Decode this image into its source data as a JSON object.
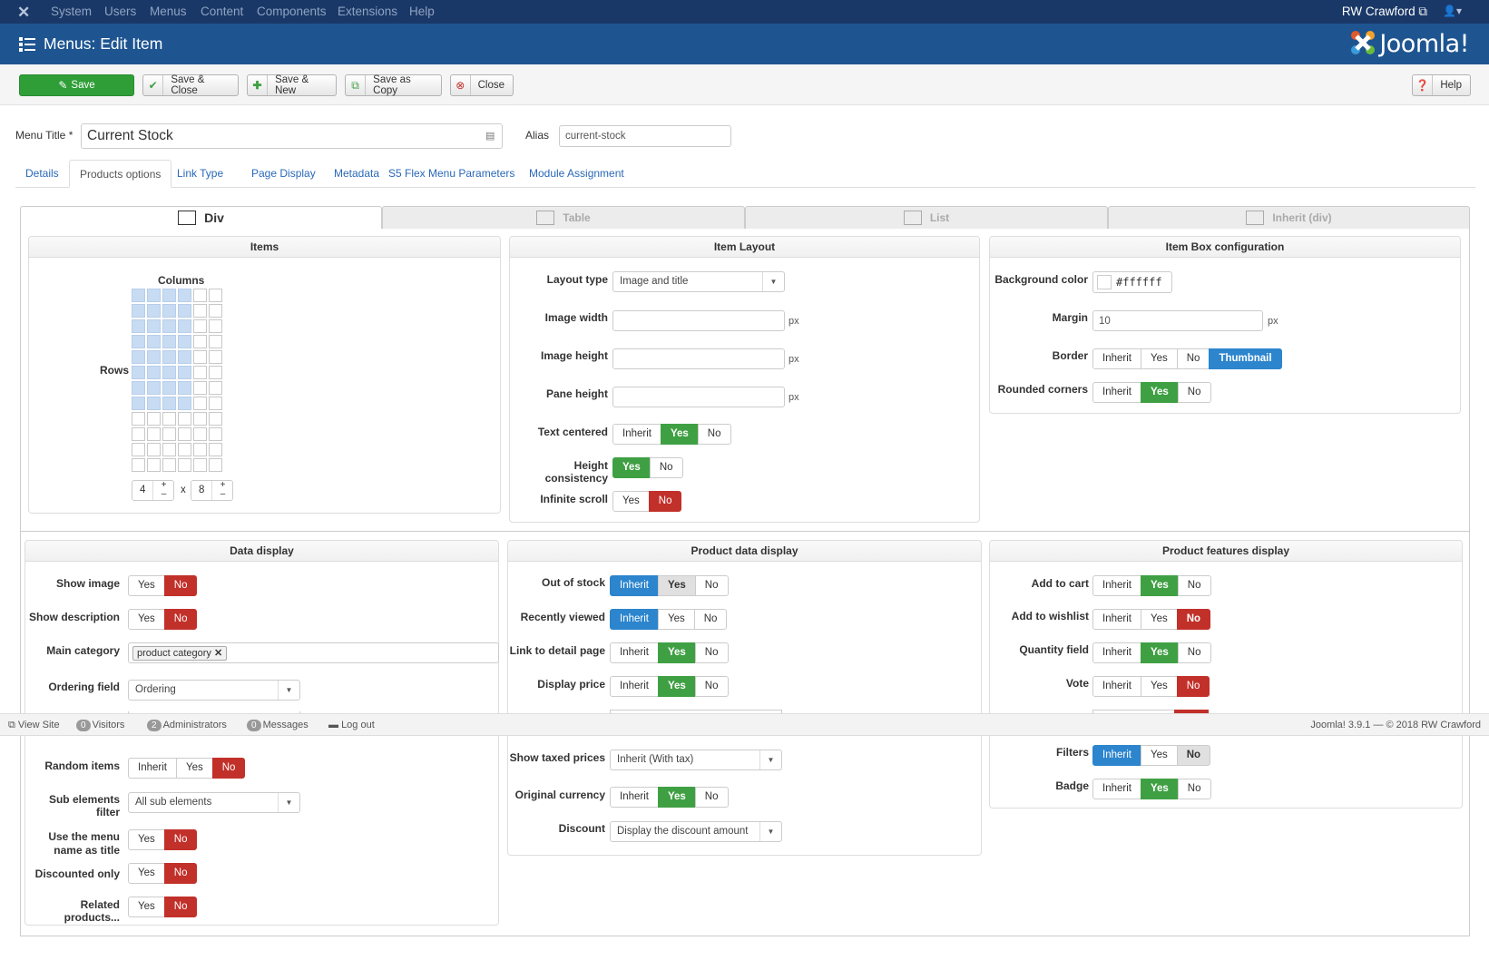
{
  "topnav": {
    "items": [
      "System",
      "Users",
      "Menus",
      "Content",
      "Components",
      "Extensions",
      "Help"
    ],
    "user": "RW Crawford"
  },
  "header": {
    "title": "Menus: Edit Item",
    "brand": "Joomla!"
  },
  "toolbar": {
    "save": "Save",
    "save_close": "Save & Close",
    "save_new": "Save & New",
    "save_copy": "Save as Copy",
    "close": "Close",
    "help": "Help"
  },
  "form": {
    "menu_title_label": "Menu Title *",
    "menu_title_value": "Current Stock",
    "alias_label": "Alias",
    "alias_value": "current-stock"
  },
  "tabs": [
    "Details",
    "Products options",
    "Link Type",
    "Page Display",
    "Metadata",
    "S5 Flex Menu Parameters",
    "Module Assignment"
  ],
  "layout_tabs": [
    "Div",
    "Table",
    "List",
    "Inherit (div)"
  ],
  "items_panel": {
    "title": "Items",
    "columns_label": "Columns",
    "rows_label": "Rows",
    "cols_value": "4",
    "rows_value": "8",
    "times": "x",
    "plus": "+",
    "minus": "–",
    "selected_cols": 4,
    "selected_rows": 8,
    "grid_cols": 6,
    "grid_rows": 12
  },
  "item_layout": {
    "title": "Item Layout",
    "layout_type_label": "Layout type",
    "layout_type_value": "Image and title",
    "image_width_label": "Image width",
    "image_height_label": "Image height",
    "pane_height_label": "Pane height",
    "px": "px",
    "text_centered_label": "Text centered",
    "height_consistency_label": "Height consistency",
    "infinite_scroll_label": "Infinite scroll"
  },
  "item_box": {
    "title": "Item Box configuration",
    "bg_label": "Background color",
    "bg_value": "#ffffff",
    "margin_label": "Margin",
    "margin_value": "10",
    "border_label": "Border",
    "rounded_label": "Rounded corners"
  },
  "labels": {
    "inherit": "Inherit",
    "yes": "Yes",
    "no": "No",
    "thumbnail": "Thumbnail"
  },
  "data_display": {
    "title": "Data display",
    "show_image": "Show image",
    "show_description": "Show description",
    "main_category": "Main category",
    "category_tag": "product category",
    "ordering_field": "Ordering field",
    "ordering_value": "Ordering",
    "random_items": "Random items",
    "sub_filter": "Sub elements filter",
    "sub_filter_value": "All sub elements",
    "use_menu_name_1": "Use the menu",
    "use_menu_name_2": "name as title",
    "discounted_only": "Discounted only",
    "related_products": "Related products..."
  },
  "product_data": {
    "title": "Product data display",
    "out_of_stock": "Out of stock",
    "recently_viewed": "Recently viewed",
    "link_detail": "Link to detail page",
    "display_price": "Display price",
    "show_taxed": "Show taxed prices",
    "taxed_value": "Inherit (With tax)",
    "original_currency": "Original currency",
    "discount": "Discount",
    "discount_value": "Display the discount amount"
  },
  "features": {
    "title": "Product features display",
    "add_cart": "Add to cart",
    "add_wishlist": "Add to wishlist",
    "quantity": "Quantity field",
    "vote": "Vote",
    "filters": "Filters",
    "badge": "Badge"
  },
  "footer": {
    "view_site": "View Site",
    "visitors_count": "0",
    "visitors": "Visitors",
    "admins_count": "2",
    "admins": "Administrators",
    "messages_count": "0",
    "messages": "Messages",
    "logout": "Log out",
    "version": "Joomla! 3.9.1 — © 2018 RW Crawford"
  },
  "colors": {
    "nav": "#1a3867",
    "header": "#1e5591",
    "save": "#2f9e37",
    "yes": "#3fa043",
    "no": "#c2302a",
    "inherit_active": "#2c85cd"
  }
}
